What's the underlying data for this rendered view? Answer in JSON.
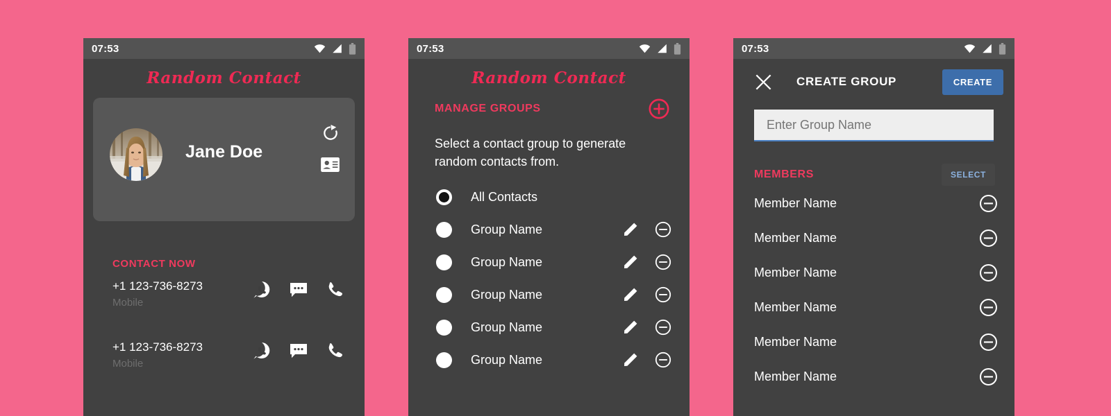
{
  "theme": {
    "page_background": "#f4668c",
    "screen_background": "#414141",
    "card_background": "#575757",
    "accent_pink": "#ef3a5e",
    "logo_pink": "#ef2a54",
    "button_blue": "#3d6eab",
    "select_text_blue": "#8cb2e0",
    "input_background": "#eeeeee",
    "text_primary": "#ffffff",
    "text_muted": "#6e6e6e"
  },
  "status_bar": {
    "time": "07:53",
    "icons": [
      "wifi-icon",
      "signal-icon",
      "battery-icon"
    ]
  },
  "app": {
    "logo_text": "Random Contact"
  },
  "screen_contact": {
    "profile": {
      "name": "Jane Doe",
      "avatar_alt": "contact-photo",
      "refresh_icon": "refresh-icon",
      "badge_icon": "contact-card-icon"
    },
    "contact_now_title": "CONTACT NOW",
    "numbers": [
      {
        "number": "+1 123-736-8273",
        "label": "Mobile",
        "actions": [
          "whatsapp-icon",
          "message-icon",
          "call-icon"
        ]
      },
      {
        "number": "+1 123-736-8273",
        "label": "Mobile",
        "actions": [
          "whatsapp-icon",
          "message-icon",
          "call-icon"
        ]
      }
    ]
  },
  "screen_groups": {
    "title": "MANAGE GROUPS",
    "add_icon": "add-circle-icon",
    "description": "Select a contact group to generate random contacts from.",
    "items": [
      {
        "label": "All Contacts",
        "selected": true,
        "has_tools": false
      },
      {
        "label": "Group Name",
        "selected": false,
        "has_tools": true
      },
      {
        "label": "Group Name",
        "selected": false,
        "has_tools": true
      },
      {
        "label": "Group Name",
        "selected": false,
        "has_tools": true
      },
      {
        "label": "Group Name",
        "selected": false,
        "has_tools": true
      },
      {
        "label": "Group Name",
        "selected": false,
        "has_tools": true
      }
    ]
  },
  "screen_create_group": {
    "close_icon": "close-icon",
    "title": "CREATE GROUP",
    "create_label": "CREATE",
    "group_name_value": "",
    "group_name_placeholder": "Enter Group Name",
    "members_title": "MEMBERS",
    "select_label": "SELECT",
    "members": [
      {
        "name": "Member Name"
      },
      {
        "name": "Member Name"
      },
      {
        "name": "Member Name"
      },
      {
        "name": "Member Name"
      },
      {
        "name": "Member Name"
      },
      {
        "name": "Member Name"
      }
    ]
  }
}
